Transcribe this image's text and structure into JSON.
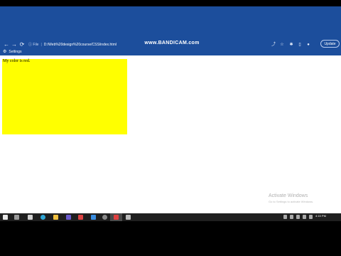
{
  "browser": {
    "nav": {
      "back_icon": "←",
      "forward_icon": "→",
      "reload_icon": "⟳"
    },
    "address": {
      "info_icon": "ⓘ",
      "scheme_label": "File",
      "url": "D:/Web%20design%20course/CSS/index.html"
    },
    "toolbar_icons": [
      "share-icon",
      "star-icon",
      "extensions-icon",
      "sidepanel-icon",
      "profile-icon"
    ],
    "update_label": "Update"
  },
  "overlay": {
    "watermark": "www.BANDICAM.com"
  },
  "bookmarks": {
    "settings_label": "Settings",
    "gear_icon": "⚙"
  },
  "page": {
    "yellow_box_text": "My color is red."
  },
  "watermark": {
    "title": "Activate Windows",
    "subtitle": "Go to Settings to activate Windows."
  },
  "taskbar": {
    "time": "4:15 PM",
    "date": ""
  },
  "colors": {
    "toolbar": "#1c4e9c",
    "box": "#ffff00",
    "taskbar": "#1f1f1f"
  }
}
